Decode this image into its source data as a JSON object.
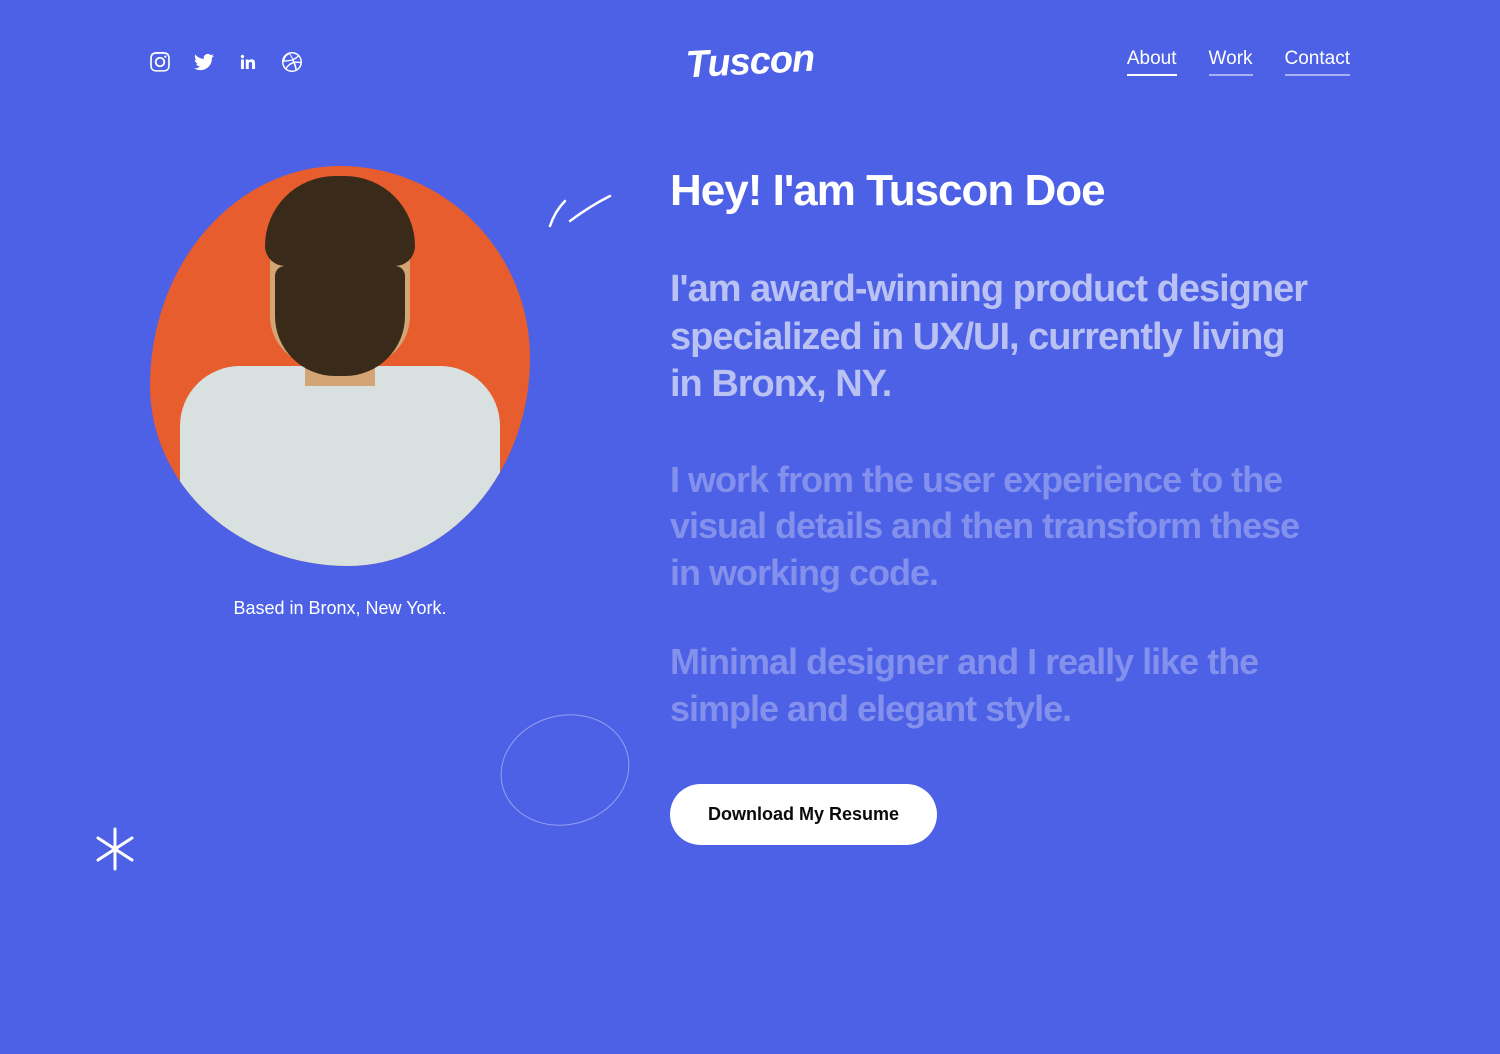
{
  "brand": "Tuscon",
  "social": {
    "instagram": "instagram-icon",
    "twitter": "twitter-icon",
    "linkedin": "linkedin-icon",
    "dribbble": "dribbble-icon"
  },
  "nav": {
    "about": "About",
    "work": "Work",
    "contact": "Contact"
  },
  "hero": {
    "location": "Based in Bronx, New York.",
    "headline": "Hey! I'am Tuscon Doe",
    "subhead": "I'am award-winning product designer specialized in UX/UI, currently living in Bronx, NY.",
    "para1": "I work from the user experience to the visual details and then transform these in working code.",
    "para2": "Minimal designer and I really like the simple and elegant style.",
    "cta": "Download My Resume"
  },
  "colors": {
    "background": "#4c61e6",
    "accent": "#e85d2e",
    "text_light": "#b9c2f2"
  }
}
